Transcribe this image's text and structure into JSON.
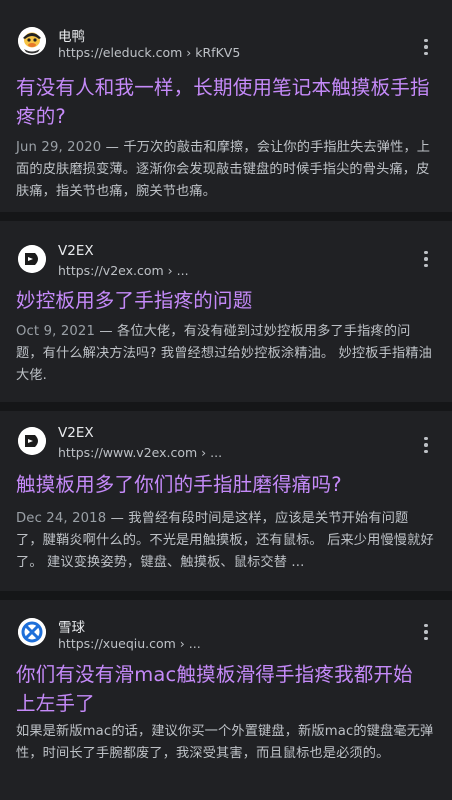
{
  "results": [
    {
      "site_name": "电鸭",
      "url": "https://eleduck.com › kRfKV5",
      "title": "有没有人和我一样，长期使用笔记本触摸板手指疼的?",
      "date": "Jun 29, 2020",
      "snippet": "千万次的敲击和摩擦，会让你的手指肚失去弹性，上面的皮肤磨损变薄。逐渐你会发现敲击键盘的时候手指尖的骨头痛，皮肤痛，指关节也痛，腕关节也痛。",
      "icon": "duck-logo-icon"
    },
    {
      "site_name": "V2EX",
      "url": "https://v2ex.com › ...",
      "title": "妙控板用多了手指疼的问题",
      "date": "Oct 9, 2021",
      "snippet": "各位大佬，有没有碰到过妙控板用多了手指疼的问题，有什么解决方法吗? 我曾经想过给妙控板涂精油。 妙控板手指精油大佬.",
      "icon": "v2ex-logo-icon"
    },
    {
      "site_name": "V2EX",
      "url": "https://www.v2ex.com › ...",
      "title": "触摸板用多了你们的手指肚磨得痛吗?",
      "date": "Dec 24, 2018",
      "snippet": "我曾经有段时间是这样，应该是关节开始有问题了，腱鞘炎啊什么的。不光是用触摸板，还有鼠标。 后来少用慢慢就好了。 建议变换姿势，键盘、触摸板、鼠标交替 ...",
      "icon": "v2ex-logo-icon"
    },
    {
      "site_name": "雪球",
      "url": "https://xueqiu.com › ...",
      "title": "你们有没有滑mac触摸板滑得手指疼我都开始上左手了",
      "date": "",
      "snippet": "如果是新版mac的话，建议你买一个外置键盘，新版mac的键盘毫无弹性，时间长了手腕都废了，我深受其害，而且鼠标也是必须的。",
      "icon": "xueqiu-logo-icon"
    }
  ],
  "date_separator": " — ",
  "colors": {
    "background": "#202124",
    "divider": "#151618",
    "title": "#c58af9",
    "text": "#bdc1c6"
  }
}
